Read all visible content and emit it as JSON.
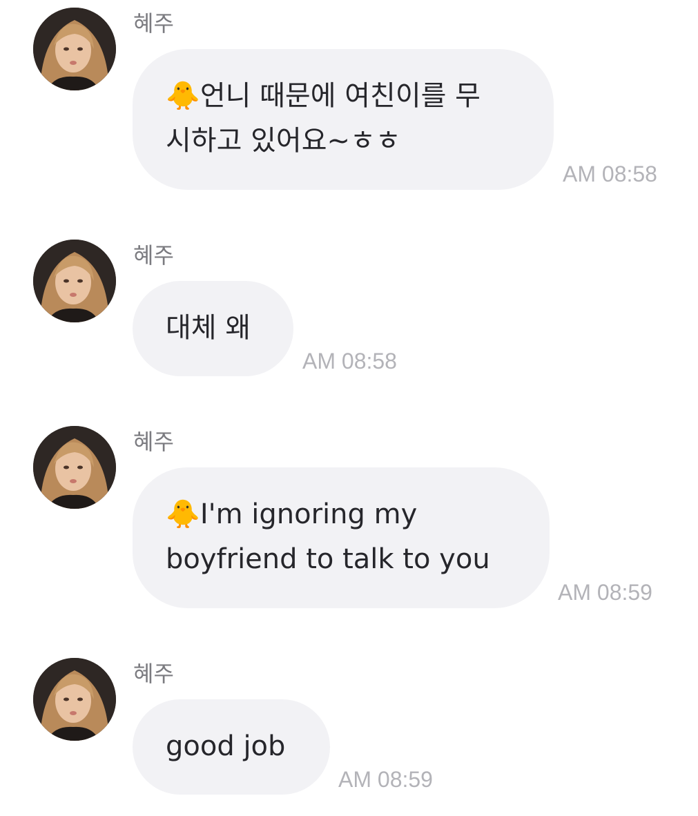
{
  "chat": {
    "messages": [
      {
        "sender": "혜주",
        "emoji": "🐥",
        "lines": [
          "언니 때문에 여친이를 무",
          "시하고 있어요~ㅎㅎ"
        ],
        "time": "AM 08:58"
      },
      {
        "sender": "혜주",
        "emoji": "",
        "lines": [
          "대체 왜"
        ],
        "time": "AM 08:58"
      },
      {
        "sender": "혜주",
        "emoji": "🐥",
        "lines": [
          "I'm ignoring my",
          "boyfriend to talk to you"
        ],
        "time": "AM 08:59"
      },
      {
        "sender": "혜주",
        "emoji": "",
        "lines": [
          "good job"
        ],
        "time": "AM 08:59"
      }
    ]
  },
  "colors": {
    "bubble": "#f2f2f5",
    "text": "#26262b",
    "sender": "#7b7b80",
    "time": "#b3b3b8"
  },
  "icons": {
    "avatar": "profile-photo"
  }
}
